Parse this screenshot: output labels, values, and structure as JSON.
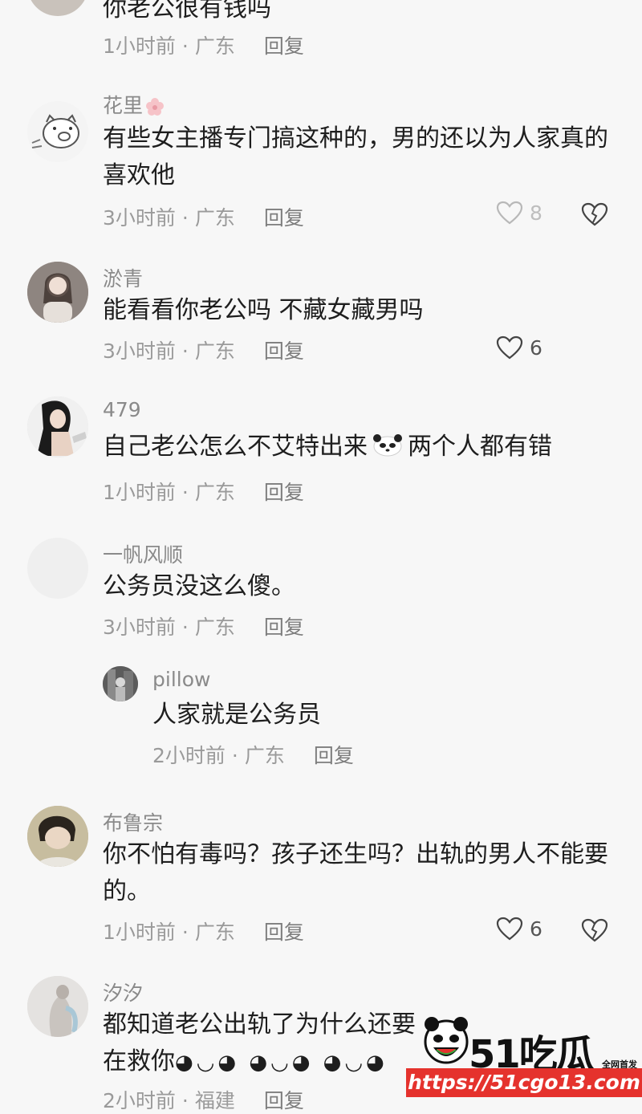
{
  "comments": [
    {
      "username": "",
      "text": "你老公很有钱吗",
      "time": "1小时前",
      "location": "广东",
      "reply_label": "回复"
    },
    {
      "username": "花里",
      "username_icon": "blossom-icon",
      "text": "有些女主播专门搞这种的，男的还以为人家真的喜欢他",
      "time": "3小时前",
      "location": "广东",
      "reply_label": "回复",
      "likes": "8"
    },
    {
      "username": "淤青",
      "text": "能看看你老公吗 不藏女藏男吗",
      "time": "3小时前",
      "location": "广东",
      "reply_label": "回复",
      "likes": "6"
    },
    {
      "username": "479",
      "text_before": "自己老公怎么不艾特出来",
      "text_after": "两个人都有错",
      "time": "1小时前",
      "location": "广东",
      "reply_label": "回复"
    },
    {
      "username": "一帆风顺",
      "text": "公务员没这么傻。",
      "time": "3小时前",
      "location": "广东",
      "reply_label": "回复"
    },
    {
      "username": "pillow",
      "text": "人家就是公务员",
      "time": "2小时前",
      "location": "广东",
      "reply_label": "回复"
    },
    {
      "username": "布鲁宗",
      "text": "你不怕有毒吗？孩子还生吗？出轨的男人不能要的。",
      "time": "1小时前",
      "location": "广东",
      "reply_label": "回复",
      "likes": "6"
    },
    {
      "username": "汐汐",
      "text": "都知道老公出轨了为什么还要",
      "text_line2": "在救你",
      "time": "2小时前",
      "location": "福建",
      "reply_label": "回复"
    }
  ],
  "separator": "·",
  "watermark": {
    "brand": "51吃瓜",
    "badge": "全网首发",
    "url": "https://51cgo13.com"
  },
  "colors": {
    "background": "#f7f7f7",
    "username": "#8a8a8a",
    "meta": "#9a9a9a",
    "watermark_red": "#e5322d"
  }
}
